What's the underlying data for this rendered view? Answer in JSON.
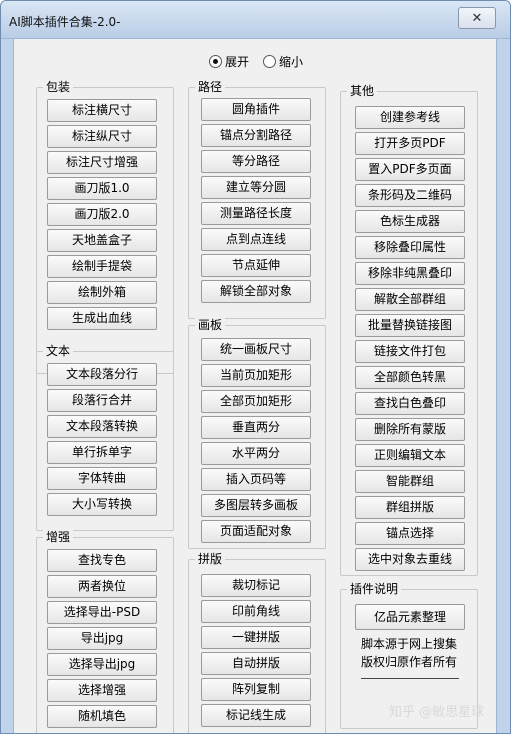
{
  "window": {
    "title": "AI脚本插件合集-2.0-",
    "close_label": "✕"
  },
  "view_mode": {
    "expand_label": "展开",
    "collapse_label": "缩小",
    "selected": "展开"
  },
  "groups": {
    "packaging": {
      "label": "包装",
      "buttons": [
        "标注横尺寸",
        "标注纵尺寸",
        "标注尺寸增强",
        "画刀版1.0",
        "画刀版2.0",
        "天地盖盒子",
        "绘制手提袋",
        "绘制外箱",
        "生成出血线"
      ]
    },
    "text": {
      "label": "文本",
      "buttons": [
        "文本段落分行",
        "段落行合并",
        "文本段落转换",
        "单行拆单字",
        "字体转曲",
        "大小写转换"
      ]
    },
    "enhance": {
      "label": "增强",
      "buttons": [
        "查找专色",
        "两者换位",
        "选择导出-PSD",
        "导出jpg",
        "选择导出jpg",
        "选择增强",
        "随机填色"
      ]
    },
    "path": {
      "label": "路径",
      "buttons": [
        "圆角插件",
        "锚点分割路径",
        "等分路径",
        "建立等分圆",
        "测量路径长度",
        "点到点连线",
        "节点延伸",
        "解锁全部对象"
      ]
    },
    "artboard": {
      "label": "画板",
      "buttons": [
        "统一画板尺寸",
        "当前页加矩形",
        "全部页加矩形",
        "垂直两分",
        "水平两分",
        "插入页码等",
        "多图层转多画板",
        "页面适配对象"
      ]
    },
    "imposition": {
      "label": "拼版",
      "buttons": [
        "裁切标记",
        "印前角线",
        "一键拼版",
        "自动拼版",
        "阵列复制",
        "标记线生成"
      ]
    },
    "other": {
      "label": "其他",
      "buttons": [
        "创建参考线",
        "打开多页PDF",
        "置入PDF多页面",
        "条形码及二维码",
        "色标生成器",
        "移除叠印属性",
        "移除非纯黑叠印",
        "解散全部群组",
        "批量替换链接图",
        "链接文件打包",
        "全部颜色转黑",
        "查找白色叠印",
        "删除所有蒙版",
        "正则编辑文本",
        "智能群组",
        "群组拼版",
        "锚点选择",
        "选中对象去重线"
      ]
    },
    "plugin_info": {
      "label": "插件说明",
      "button": "亿品元素整理",
      "note_line1": "脚本源于网上搜集",
      "note_line2": "版权归原作者所有"
    }
  },
  "watermark": "知乎 @敏思星球"
}
